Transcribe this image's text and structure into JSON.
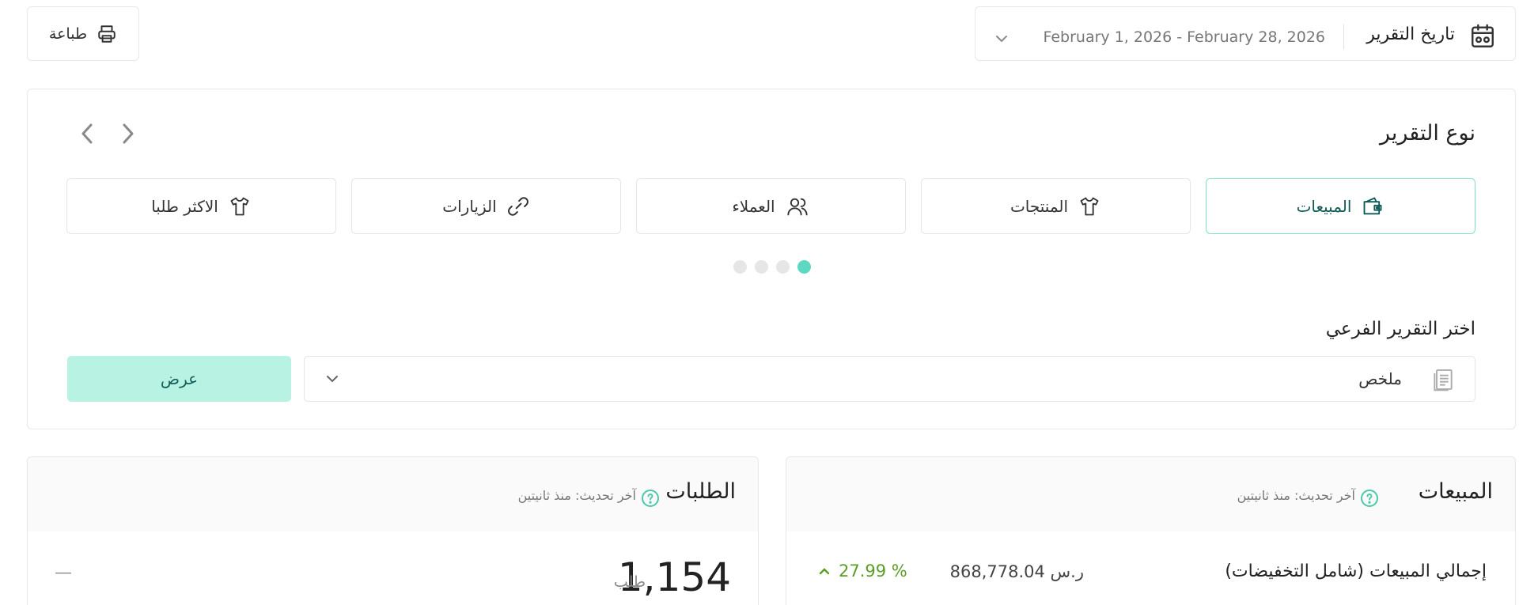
{
  "toolbar": {
    "print_label": "طباعة",
    "report_date_label": "تاريخ التقرير",
    "date_range": "February 1, 2026 - February 28, 2026"
  },
  "report": {
    "title": "نوع التقرير",
    "tabs": [
      {
        "label": "المبيعات",
        "icon": "wallet-icon",
        "active": true
      },
      {
        "label": "المنتجات",
        "icon": "tshirt-icon",
        "active": false
      },
      {
        "label": "العملاء",
        "icon": "users-icon",
        "active": false
      },
      {
        "label": "الزيارات",
        "icon": "link-icon",
        "active": false
      },
      {
        "label": "الاكثر طلبا",
        "icon": "tshirt-icon",
        "active": false
      }
    ],
    "carousel_pages": 4,
    "carousel_active_page": 1,
    "sub_report_label": "اختر التقرير الفرعي",
    "sub_report_value": "ملخص",
    "show_button": "عرض"
  },
  "sales_stats": {
    "title": "المبيعات",
    "updated": "آخر تحديث: منذ ثانيتين",
    "row_label": "إجمالي المبيعات (شامل التخفيضات)",
    "row_value": "868,778.04 ر.س",
    "row_change": "27.99 %"
  },
  "orders_stats": {
    "title": "الطلبات",
    "updated": "آخر تحديث: منذ ثانيتين",
    "count": "1,154",
    "unit": "طلب",
    "change": "—"
  },
  "colors": {
    "accent": "#5dd9c1",
    "accent_light": "#b8f2e2",
    "accent_dark": "#0e5a56",
    "positive": "#5a9e24",
    "help_icon": "#4cc9a8"
  }
}
